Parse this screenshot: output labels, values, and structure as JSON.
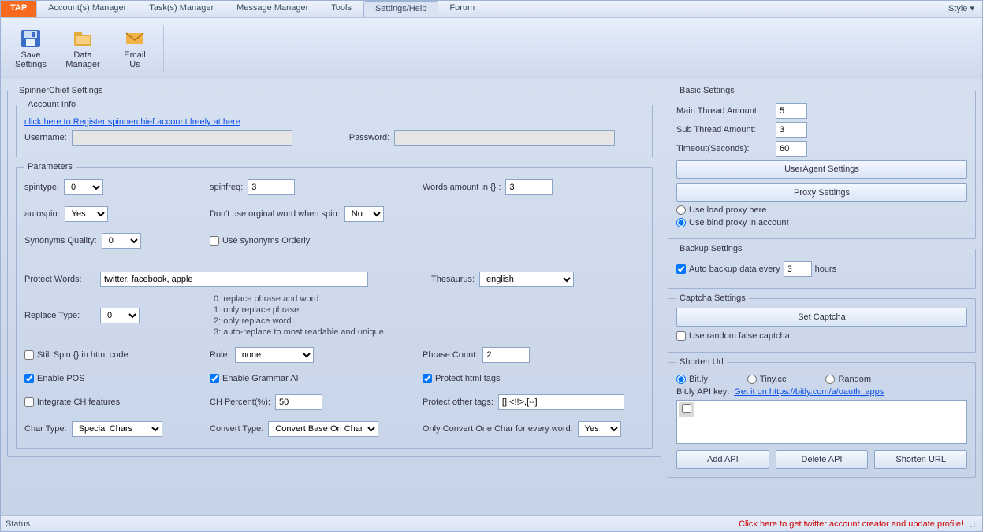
{
  "menu": {
    "tap": "TAP",
    "items": [
      "Account(s) Manager",
      "Task(s) Manager",
      "Message Manager",
      "Tools",
      "Settings/Help",
      "Forum"
    ],
    "style": "Style  ▾"
  },
  "ribbon": {
    "save": {
      "l1": "Save",
      "l2": "Settings"
    },
    "data": {
      "l1": "Data",
      "l2": "Manager"
    },
    "email": {
      "l1": "Email",
      "l2": "Us"
    }
  },
  "spinner": {
    "legend": "SpinnerChief Settings",
    "account": {
      "legend": "Account Info",
      "register_link": "click here to Register spinnerchief account freely at here",
      "username_label": "Username:",
      "username": "",
      "password_label": "Password:",
      "password": ""
    },
    "params": {
      "legend": "Parameters",
      "spintype_label": "spintype:",
      "spintype": "0",
      "spinfreq_label": "spinfreq:",
      "spinfreq": "3",
      "wordsin_label": "Words amount in {} :",
      "wordsin": "3",
      "autospin_label": "autospin:",
      "autospin": "Yes",
      "dontuse_label": "Don't use orginal word when spin:",
      "dontuse": "No",
      "synq_label": "Synonyms Quality:",
      "synq": "0",
      "useorderly_label": "Use synonyms Orderly",
      "protect_label": "Protect Words:",
      "protect": "twitter, facebook, apple",
      "thesaurus_label": "Thesaurus:",
      "thesaurus": "english",
      "replacetype_label": "Replace Type:",
      "replacetype": "0",
      "replace_hints": "0: replace phrase and word\n1: only replace phrase\n2: only replace word\n3: auto-replace to most readable and unique",
      "stillspin_label": "Still Spin {} in html code",
      "rule_label": "Rule:",
      "rule": "none",
      "phrasecount_label": "Phrase Count:",
      "phrasecount": "2",
      "enablepos_label": "Enable POS",
      "enablegrammar_label": "Enable Grammar AI",
      "protecthtml_label": "Protect html tags",
      "integratech_label": "Integrate CH features",
      "chpercent_label": "CH Percent(%):",
      "chpercent": "50",
      "protecttags_label": "Protect other tags:",
      "protecttags": "[],<!!>,[--]",
      "chartype_label": "Char Type:",
      "chartype": "Special Chars",
      "converttype_label": "Convert Type:",
      "converttype": "Convert Base On Char",
      "onlyone_label": "Only Convert One Char for every word:",
      "onlyone": "Yes"
    }
  },
  "basic": {
    "legend": "Basic Settings",
    "mainthread_label": "Main Thread Amount:",
    "mainthread": "5",
    "subthread_label": "Sub Thread Amount:",
    "subthread": "3",
    "timeout_label": "Timeout(Seconds):",
    "timeout": "60",
    "useragent_btn": "UserAgent Settings",
    "proxy_btn": "Proxy Settings",
    "useload_label": "Use load proxy here",
    "usebind_label": "Use bind proxy in account"
  },
  "backup": {
    "legend": "Backup Settings",
    "auto_label": "Auto backup data every",
    "hours_val": "3",
    "hours_label": "hours"
  },
  "captcha": {
    "legend": "Captcha Settings",
    "set_btn": "Set Captcha",
    "randomfalse_label": "Use random false captcha"
  },
  "shorten": {
    "legend": "Shorten Url",
    "bitly": "Bit.ly",
    "tinycc": "Tiny.cc",
    "random": "Random",
    "apikey_label": "Bit.ly API key:",
    "apikey_link": "Get it on https://bitly.com/a/oauth_apps",
    "api_entry": "",
    "add_btn": "Add API",
    "del_btn": "Delete API",
    "short_btn": "Shorten URL"
  },
  "footer": {
    "status": "Status",
    "redlink": "Click here to get twitter account creator and update profile!"
  }
}
